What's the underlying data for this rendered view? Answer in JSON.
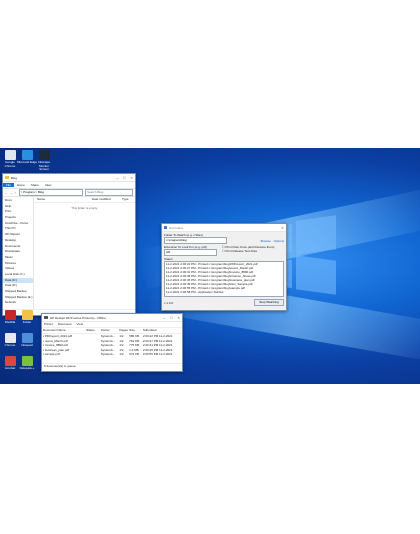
{
  "desktop_icons": [
    {
      "label": "Google Chrome",
      "color": "#dfe6ef"
    },
    {
      "label": "Microsoft Edge",
      "color": "#2a8fe0"
    },
    {
      "label": "Inkscape Monitor Screen",
      "color": "#1d2b3a"
    }
  ],
  "desktop_icons_bottom": [
    {
      "label": "FileZilla",
      "color": "#c62828"
    },
    {
      "label": "Folder",
      "color": "#f0c24a"
    },
    {
      "label": "Chrome",
      "color": "#e8e8e8"
    },
    {
      "label": "Notepad",
      "color": "#4f8fd8"
    },
    {
      "label": "Acrobat",
      "color": "#d84a3a"
    },
    {
      "label": "Notepad++",
      "color": "#7bc043"
    }
  ],
  "explorer": {
    "title": "Blog",
    "tabs": [
      "File",
      "Home",
      "Share",
      "View"
    ],
    "path": "> Program > Blog",
    "search_placeholder": "Search Blog",
    "headers": [
      "Name",
      "Date modified",
      "Type"
    ],
    "empty_text": "This folder is empty.",
    "nav": [
      "Docs",
      "Help",
      "Print",
      "Projects",
      "OneDrive - Perso",
      "This PC",
      "3D Objects",
      "Desktop",
      "Documents",
      "Downloads",
      "Music",
      "Pictures",
      "Videos",
      "Local Disk (C:)",
      "Data (D:)",
      "Data (D:)",
      "Shipped Backup",
      "Shipped Backup (E:)",
      "Network"
    ],
    "status": "0 items"
  },
  "dialog": {
    "title": "Hot Folder",
    "folder_label": "Folder To Watch (e.g. c:\\files)",
    "folder_value": "c:\\program\\blog",
    "browse_label": "Browse",
    "options_label": "Options",
    "ext_label": "Extension To Look For (e.g. pdf)",
    "ext_value": "pdf",
    "check1": "Print Files Once (and Rename them)",
    "check2": "Print Release Text Files",
    "status_label": "Status",
    "log": [
      "11-2-2021 2:00:22 PM  - Printed c:\\program\\blog\\PDFreport_2021.pdf",
      "11-2-2021 2:00:27 PM  - Printed c:\\program\\blog\\report_March.pdf",
      "11-2-2021 2:00:31 PM  - Printed c:\\program\\blog\\Invoice_8890.pdf",
      "11-2-2021 2:00:38 PM  - Printed c:\\program\\blog\\Finance_Sheet.pdf",
      "11-2-2021 2:00:45 PM  - Printed c:\\program\\blog\\business_plan.pdf",
      "11-2-2021 2:00:49 PM  - Printed c:\\program\\blog\\Doc_Sample.pdf",
      "11-2-2021 2:00:55 PM  - Printed c:\\program\\blog\\sample.pdf",
      "11-2-2021 2:00:58 PM  - Application Started"
    ],
    "version": "v 1.0.0",
    "stop_button": "Stop Watching"
  },
  "printq": {
    "title": "HP Deskjet 3070 series Printer(s) - Offline",
    "menu": [
      "Printer",
      "Document",
      "View"
    ],
    "headers": [
      "Document Name",
      "Status",
      "Owner",
      "Pages",
      "Size",
      "Submitted"
    ],
    "rows": [
      [
        "PDFreport_2021.pdf",
        "",
        "SystemA...",
        "1/2",
        "586 KB",
        "2:00:22 PM 11-2-2021"
      ],
      [
        "report_March.pdf",
        "",
        "SystemA...",
        "1/2",
        "781 KB",
        "2:00:27 PM 11-2-2021"
      ],
      [
        "Invoice_8890.pdf",
        "",
        "SystemA...",
        "1/2",
        "775 KB",
        "2:00:31 PM 11-2-2021"
      ],
      [
        "business_plan.pdf",
        "",
        "SystemA...",
        "1/2",
        "1.2 MB",
        "2:00:45 PM 11-2-2021"
      ],
      [
        "sample.pdf",
        "",
        "SystemA...",
        "1/2",
        "973 KB",
        "2:00:55 PM 11-2-2021"
      ]
    ],
    "status": "5 document(s) in queue"
  }
}
